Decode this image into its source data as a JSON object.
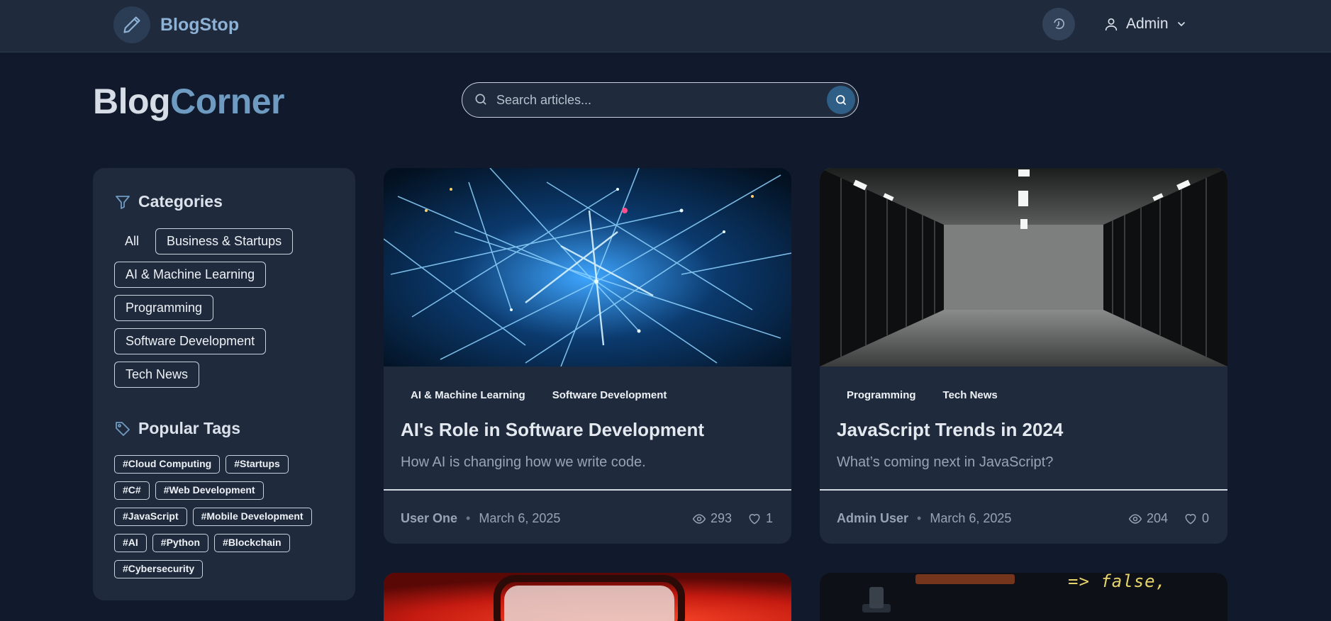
{
  "navbar": {
    "brand": "BlogStop",
    "user": "Admin"
  },
  "hero": {
    "title_part1": "Blog",
    "title_part2": "Corner",
    "search_placeholder": "Search articles..."
  },
  "sidebar": {
    "categories_title": "Categories",
    "categories": [
      "All",
      "Business & Startups",
      "AI & Machine Learning",
      "Programming",
      "Software Development",
      "Tech News"
    ],
    "tags_title": "Popular Tags",
    "tags": [
      "#Cloud Computing",
      "#Startups",
      "#C#",
      "#Web Development",
      "#JavaScript",
      "#Mobile Development",
      "#AI",
      "#Python",
      "#Blockchain",
      "#Cybersecurity"
    ]
  },
  "posts": [
    {
      "categories": [
        "AI & Machine Learning",
        "Software Development"
      ],
      "title": "AI's Role in Software Development",
      "excerpt": "How AI is changing how we write code.",
      "author": "User One",
      "date": "March 6, 2025",
      "views": "293",
      "likes": "1"
    },
    {
      "categories": [
        "Programming",
        "Tech News"
      ],
      "title": "JavaScript Trends in 2024",
      "excerpt": "What’s coming next in JavaScript?",
      "author": "Admin User",
      "date": "March 6, 2025",
      "views": "204",
      "likes": "0"
    },
    {
      "code_snippet": "=> false,"
    }
  ],
  "colors": {
    "background": "#111a2c",
    "surface": "#1f2a3c",
    "accent": "#6f9bc2",
    "search_button": "#2f5f86"
  }
}
